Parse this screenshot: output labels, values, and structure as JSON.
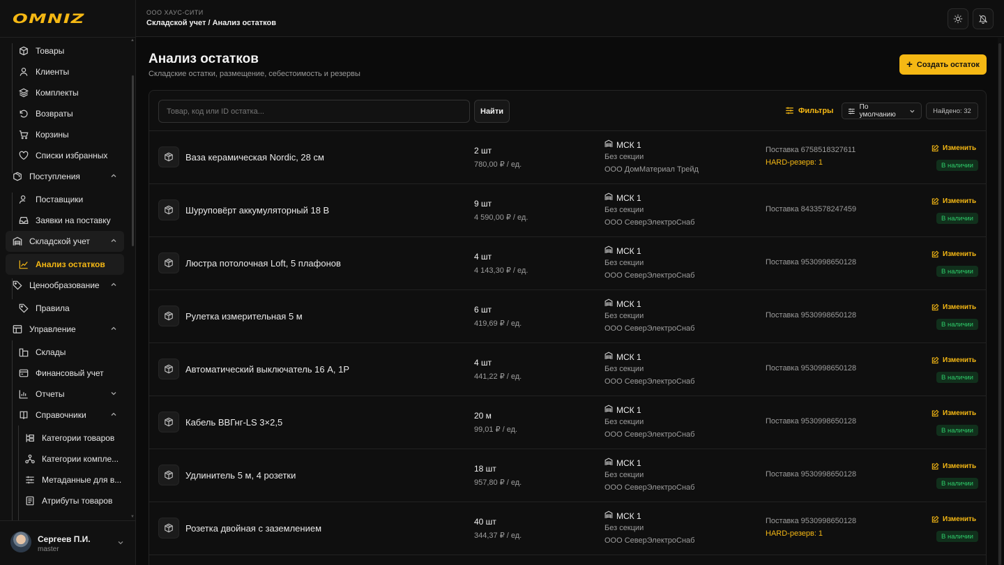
{
  "brand": {
    "logo": "OMNIZ",
    "accent": "#f5b814"
  },
  "header": {
    "org": "ООО ХАУС-СИТИ",
    "breadcrumb": "Складской учет / Анализ остатков",
    "icons": [
      "sun-icon",
      "bell-icon"
    ]
  },
  "sidebar": {
    "items": [
      {
        "label": "Товары",
        "icon": "box-icon"
      },
      {
        "label": "Клиенты",
        "icon": "user-icon"
      },
      {
        "label": "Комплекты",
        "icon": "layers-icon"
      },
      {
        "label": "Возвраты",
        "icon": "return-icon"
      },
      {
        "label": "Корзины",
        "icon": "cart-icon"
      },
      {
        "label": "Списки избранных",
        "icon": "heart-icon"
      },
      {
        "label": "Поступления",
        "icon": "package-icon",
        "group": true
      },
      {
        "label": "Поставщики",
        "icon": "user-icon"
      },
      {
        "label": "Заявки на поставку",
        "icon": "inbox-icon"
      },
      {
        "label": "Складской учет",
        "icon": "warehouse-icon",
        "group": true
      },
      {
        "label": "Анализ остатков",
        "icon": "chart-icon",
        "active": true
      },
      {
        "label": "Ценообразование",
        "icon": "tag-icon",
        "group": true
      },
      {
        "label": "Правила",
        "icon": "tag-icon"
      },
      {
        "label": "Управление",
        "icon": "table-icon",
        "group": true
      },
      {
        "label": "Склады",
        "icon": "warehouse-icon"
      },
      {
        "label": "Финансовый учет",
        "icon": "wallet-icon"
      },
      {
        "label": "Отчеты",
        "icon": "bar-chart-icon"
      },
      {
        "label": "Справочники",
        "icon": "book-icon"
      },
      {
        "label": "Категории товаров",
        "icon": "tree-icon"
      },
      {
        "label": "Категории компле...",
        "icon": "network-icon"
      },
      {
        "label": "Метаданные для в...",
        "icon": "sliders-icon"
      },
      {
        "label": "Атрибуты товаров",
        "icon": "doc-icon"
      }
    ]
  },
  "user": {
    "name": "Сергеев П.И.",
    "role": "master"
  },
  "page": {
    "title": "Анализ остатков",
    "subtitle": "Складские остатки, размещение, себестоимость и резервы",
    "create_label": "Создать остаток"
  },
  "toolbar": {
    "search_placeholder": "Товар, код или ID остатка...",
    "find_label": "Найти",
    "filters_label": "Фильтры",
    "sort_label": "По умолчанию",
    "found_label": "Найдено: 32"
  },
  "rows": [
    {
      "name": "Ваза керамическая Nordic, 28 см",
      "qty": "2 шт",
      "price": "780,00 ₽ / ед.",
      "warehouse": "МСК 1",
      "section": "Без секции",
      "supplier": "ООО ДомМатериал Трейд",
      "delivery": "Поставка 6758518327611",
      "reserve": "HARD-резерв: 1",
      "edit": "Изменить",
      "status": "В наличии"
    },
    {
      "name": "Шуруповёрт аккумуляторный 18 В",
      "qty": "9 шт",
      "price": "4 590,00 ₽ / ед.",
      "warehouse": "МСК 1",
      "section": "Без секции",
      "supplier": "ООО СеверЭлектроСнаб",
      "delivery": "Поставка 8433578247459",
      "reserve": "",
      "edit": "Изменить",
      "status": "В наличии"
    },
    {
      "name": "Люстра потолочная Loft, 5 плафонов",
      "qty": "4 шт",
      "price": "4 143,30 ₽ / ед.",
      "warehouse": "МСК 1",
      "section": "Без секции",
      "supplier": "ООО СеверЭлектроСнаб",
      "delivery": "Поставка 9530998650128",
      "reserve": "",
      "edit": "Изменить",
      "status": "В наличии"
    },
    {
      "name": "Рулетка измерительная 5 м",
      "qty": "6 шт",
      "price": "419,69 ₽ / ед.",
      "warehouse": "МСК 1",
      "section": "Без секции",
      "supplier": "ООО СеверЭлектроСнаб",
      "delivery": "Поставка 9530998650128",
      "reserve": "",
      "edit": "Изменить",
      "status": "В наличии"
    },
    {
      "name": "Автоматический выключатель 16 А, 1Р",
      "qty": "4 шт",
      "price": "441,22 ₽ / ед.",
      "warehouse": "МСК 1",
      "section": "Без секции",
      "supplier": "ООО СеверЭлектроСнаб",
      "delivery": "Поставка 9530998650128",
      "reserve": "",
      "edit": "Изменить",
      "status": "В наличии"
    },
    {
      "name": "Кабель ВВГнг-LS 3×2,5",
      "qty": "20 м",
      "price": "99,01 ₽ / ед.",
      "warehouse": "МСК 1",
      "section": "Без секции",
      "supplier": "ООО СеверЭлектроСнаб",
      "delivery": "Поставка 9530998650128",
      "reserve": "",
      "edit": "Изменить",
      "status": "В наличии"
    },
    {
      "name": "Удлинитель 5 м, 4 розетки",
      "qty": "18 шт",
      "price": "957,80 ₽ / ед.",
      "warehouse": "МСК 1",
      "section": "Без секции",
      "supplier": "ООО СеверЭлектроСнаб",
      "delivery": "Поставка 9530998650128",
      "reserve": "",
      "edit": "Изменить",
      "status": "В наличии"
    },
    {
      "name": "Розетка двойная с заземлением",
      "qty": "40 шт",
      "price": "344,37 ₽ / ед.",
      "warehouse": "МСК 1",
      "section": "Без секции",
      "supplier": "ООО СеверЭлектроСнаб",
      "delivery": "Поставка 9530998650128",
      "reserve": "HARD-резерв: 1",
      "edit": "Изменить",
      "status": "В наличии"
    }
  ]
}
